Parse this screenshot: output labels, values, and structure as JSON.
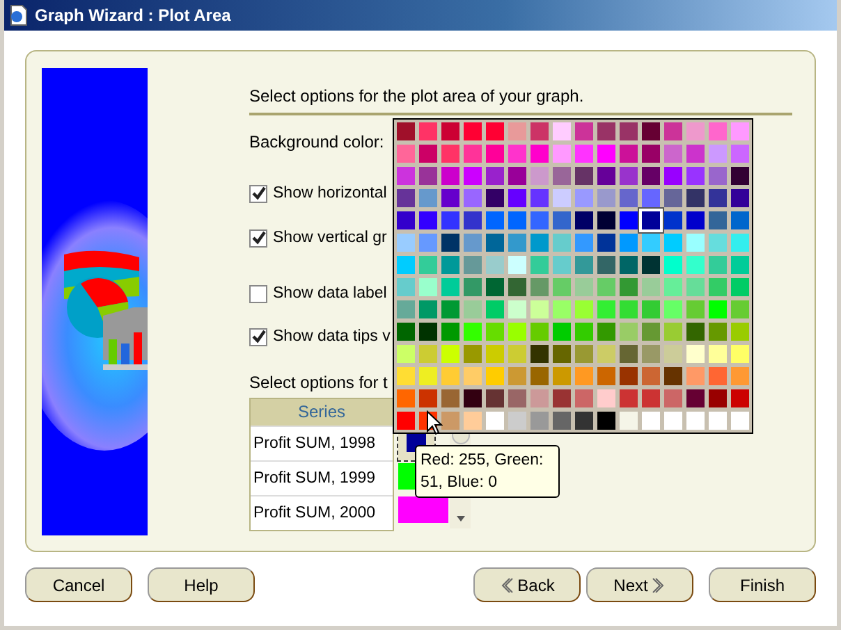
{
  "window": {
    "title": "Graph Wizard : Plot Area"
  },
  "heading": "Select options for the plot area of your graph.",
  "background_label": "Background color:",
  "options": [
    {
      "label": "Show horizontal",
      "checked": true
    },
    {
      "label": "Show vertical gr",
      "checked": true
    },
    {
      "label": "Show data label",
      "checked": false
    },
    {
      "label": "Show data tips v",
      "checked": true
    }
  ],
  "series_heading": "Select options for t",
  "series_table": {
    "header": "Series",
    "rows": [
      {
        "name": "Profit SUM, 1998",
        "color": "#000099"
      },
      {
        "name": "Profit SUM, 1999",
        "color": "#00ff00"
      },
      {
        "name": "Profit SUM, 2000",
        "color": "#ff00ff"
      }
    ]
  },
  "palette": {
    "rows": [
      {
        "swatches": [
          {
            "color": "#a0102a",
            "selected": false
          },
          {
            "color": "#ff3366",
            "selected": false
          },
          {
            "color": "#cc0033",
            "selected": false
          },
          {
            "color": "#ff0033",
            "selected": false
          },
          {
            "color": "#ff0033",
            "selected": false
          },
          {
            "color": "#e89a9a",
            "selected": false
          },
          {
            "color": "#cc3366",
            "selected": false
          },
          {
            "color": "#ffccff",
            "selected": false
          },
          {
            "color": "#cc3399",
            "selected": false
          },
          {
            "color": "#993366",
            "selected": false
          },
          {
            "color": "#993366",
            "selected": false
          },
          {
            "color": "#660033",
            "selected": false
          },
          {
            "color": "#cc3399",
            "selected": false
          },
          {
            "color": "#ee99cc",
            "selected": false
          },
          {
            "color": "#ff66cc",
            "selected": false
          },
          {
            "color": "#ff99ff",
            "selected": false
          }
        ]
      },
      {
        "swatches": [
          {
            "color": "#ff6699",
            "selected": false
          },
          {
            "color": "#cc0066",
            "selected": false
          },
          {
            "color": "#ff3366",
            "selected": false
          },
          {
            "color": "#ff3399",
            "selected": false
          },
          {
            "color": "#ff0099",
            "selected": false
          },
          {
            "color": "#ff33cc",
            "selected": false
          },
          {
            "color": "#ff00cc",
            "selected": false
          },
          {
            "color": "#ff99ff",
            "selected": false
          },
          {
            "color": "#ff33ff",
            "selected": false
          },
          {
            "color": "#ff00ff",
            "selected": false
          },
          {
            "color": "#cc1199",
            "selected": false
          },
          {
            "color": "#990066",
            "selected": false
          },
          {
            "color": "#cc66cc",
            "selected": false
          },
          {
            "color": "#cc33cc",
            "selected": false
          },
          {
            "color": "#cc99ff",
            "selected": false
          },
          {
            "color": "#cc66ff",
            "selected": false
          }
        ]
      },
      {
        "swatches": [
          {
            "color": "#cc33dd",
            "selected": false
          },
          {
            "color": "#993399",
            "selected": false
          },
          {
            "color": "#cc00cc",
            "selected": false
          },
          {
            "color": "#cc00ff",
            "selected": false
          },
          {
            "color": "#9922cc",
            "selected": false
          },
          {
            "color": "#990099",
            "selected": false
          },
          {
            "color": "#cc99cc",
            "selected": false
          },
          {
            "color": "#996699",
            "selected": false
          },
          {
            "color": "#663366",
            "selected": false
          },
          {
            "color": "#660099",
            "selected": false
          },
          {
            "color": "#9933cc",
            "selected": false
          },
          {
            "color": "#660066",
            "selected": false
          },
          {
            "color": "#9900ff",
            "selected": false
          },
          {
            "color": "#9933ff",
            "selected": false
          },
          {
            "color": "#9966cc",
            "selected": false
          },
          {
            "color": "#330033",
            "selected": false
          }
        ]
      },
      {
        "swatches": [
          {
            "color": "#663399",
            "selected": false
          },
          {
            "color": "#6699cc",
            "selected": false
          },
          {
            "color": "#6600cc",
            "selected": false
          },
          {
            "color": "#9966ff",
            "selected": false
          },
          {
            "color": "#330066",
            "selected": false
          },
          {
            "color": "#6600ff",
            "selected": false
          },
          {
            "color": "#6633ff",
            "selected": false
          },
          {
            "color": "#ccccff",
            "selected": false
          },
          {
            "color": "#9999ff",
            "selected": false
          },
          {
            "color": "#9999cc",
            "selected": false
          },
          {
            "color": "#6666cc",
            "selected": false
          },
          {
            "color": "#6666ff",
            "selected": false
          },
          {
            "color": "#666699",
            "selected": false
          },
          {
            "color": "#333366",
            "selected": false
          },
          {
            "color": "#333399",
            "selected": false
          },
          {
            "color": "#330099",
            "selected": false
          }
        ]
      },
      {
        "swatches": [
          {
            "color": "#3300cc",
            "selected": false
          },
          {
            "color": "#3300ff",
            "selected": false
          },
          {
            "color": "#3333ff",
            "selected": false
          },
          {
            "color": "#3333cc",
            "selected": false
          },
          {
            "color": "#0066ff",
            "selected": false
          },
          {
            "color": "#0066ff",
            "selected": false
          },
          {
            "color": "#3366ff",
            "selected": false
          },
          {
            "color": "#3366cc",
            "selected": false
          },
          {
            "color": "#000066",
            "selected": false
          },
          {
            "color": "#000033",
            "selected": false
          },
          {
            "color": "#0000ff",
            "selected": false
          },
          {
            "color": "#000099",
            "selected": true
          },
          {
            "color": "#0033cc",
            "selected": false
          },
          {
            "color": "#0000cc",
            "selected": false
          },
          {
            "color": "#336699",
            "selected": false
          },
          {
            "color": "#0066cc",
            "selected": false
          }
        ]
      },
      {
        "swatches": [
          {
            "color": "#99ccff",
            "selected": false
          },
          {
            "color": "#6699ff",
            "selected": false
          },
          {
            "color": "#003366",
            "selected": false
          },
          {
            "color": "#6699cc",
            "selected": false
          },
          {
            "color": "#006699",
            "selected": false
          },
          {
            "color": "#3399cc",
            "selected": false
          },
          {
            "color": "#0099cc",
            "selected": false
          },
          {
            "color": "#66cccc",
            "selected": false
          },
          {
            "color": "#3399ff",
            "selected": false
          },
          {
            "color": "#003399",
            "selected": false
          },
          {
            "color": "#0099ff",
            "selected": false
          },
          {
            "color": "#33ccff",
            "selected": false
          },
          {
            "color": "#00ccff",
            "selected": false
          },
          {
            "color": "#99ffff",
            "selected": false
          },
          {
            "color": "#66dddd",
            "selected": false
          },
          {
            "color": "#33eeee",
            "selected": false
          }
        ]
      },
      {
        "swatches": [
          {
            "color": "#00ccff",
            "selected": false
          },
          {
            "color": "#33cc99",
            "selected": false
          },
          {
            "color": "#009999",
            "selected": false
          },
          {
            "color": "#669999",
            "selected": false
          },
          {
            "color": "#99cccc",
            "selected": false
          },
          {
            "color": "#ccffff",
            "selected": false
          },
          {
            "color": "#33cc99",
            "selected": false
          },
          {
            "color": "#66cccc",
            "selected": false
          },
          {
            "color": "#339999",
            "selected": false
          },
          {
            "color": "#336666",
            "selected": false
          },
          {
            "color": "#006666",
            "selected": false
          },
          {
            "color": "#003333",
            "selected": false
          },
          {
            "color": "#00ffcc",
            "selected": false
          },
          {
            "color": "#33ffcc",
            "selected": false
          },
          {
            "color": "#33cc99",
            "selected": false
          },
          {
            "color": "#00cc99",
            "selected": false
          }
        ]
      },
      {
        "swatches": [
          {
            "color": "#66cccc",
            "selected": false
          },
          {
            "color": "#99ffcc",
            "selected": false
          },
          {
            "color": "#00cc99",
            "selected": false
          },
          {
            "color": "#339966",
            "selected": false
          },
          {
            "color": "#006633",
            "selected": false
          },
          {
            "color": "#336633",
            "selected": false
          },
          {
            "color": "#669966",
            "selected": false
          },
          {
            "color": "#66cc66",
            "selected": false
          },
          {
            "color": "#99cc99",
            "selected": false
          },
          {
            "color": "#66cc66",
            "selected": false
          },
          {
            "color": "#339933",
            "selected": false
          },
          {
            "color": "#99cc99",
            "selected": false
          },
          {
            "color": "#66ee99",
            "selected": false
          },
          {
            "color": "#66dd99",
            "selected": false
          },
          {
            "color": "#33cc66",
            "selected": false
          },
          {
            "color": "#00cc66",
            "selected": false
          }
        ]
      },
      {
        "swatches": [
          {
            "color": "#66aa99",
            "selected": false
          },
          {
            "color": "#009966",
            "selected": false
          },
          {
            "color": "#009933",
            "selected": false
          },
          {
            "color": "#99cc99",
            "selected": false
          },
          {
            "color": "#00cc66",
            "selected": false
          },
          {
            "color": "#ccffcc",
            "selected": false
          },
          {
            "color": "#ccff99",
            "selected": false
          },
          {
            "color": "#99ff66",
            "selected": false
          },
          {
            "color": "#99ff33",
            "selected": false
          },
          {
            "color": "#33ee33",
            "selected": false
          },
          {
            "color": "#33dd33",
            "selected": false
          },
          {
            "color": "#33cc33",
            "selected": false
          },
          {
            "color": "#66ff66",
            "selected": false
          },
          {
            "color": "#66cc33",
            "selected": false
          },
          {
            "color": "#00ff00",
            "selected": false
          },
          {
            "color": "#66cc33",
            "selected": false
          }
        ]
      },
      {
        "swatches": [
          {
            "color": "#006600",
            "selected": false
          },
          {
            "color": "#003300",
            "selected": false
          },
          {
            "color": "#009900",
            "selected": false
          },
          {
            "color": "#33ff00",
            "selected": false
          },
          {
            "color": "#66dd00",
            "selected": false
          },
          {
            "color": "#99ff00",
            "selected": false
          },
          {
            "color": "#66cc00",
            "selected": false
          },
          {
            "color": "#00cc00",
            "selected": false
          },
          {
            "color": "#33cc00",
            "selected": false
          },
          {
            "color": "#339900",
            "selected": false
          },
          {
            "color": "#99cc66",
            "selected": false
          },
          {
            "color": "#669933",
            "selected": false
          },
          {
            "color": "#99cc33",
            "selected": false
          },
          {
            "color": "#336600",
            "selected": false
          },
          {
            "color": "#669900",
            "selected": false
          },
          {
            "color": "#99cc00",
            "selected": false
          }
        ]
      },
      {
        "swatches": [
          {
            "color": "#ccff66",
            "selected": false
          },
          {
            "color": "#cccc33",
            "selected": false
          },
          {
            "color": "#ccff00",
            "selected": false
          },
          {
            "color": "#999900",
            "selected": false
          },
          {
            "color": "#cccc00",
            "selected": false
          },
          {
            "color": "#cccc33",
            "selected": false
          },
          {
            "color": "#333300",
            "selected": false
          },
          {
            "color": "#666600",
            "selected": false
          },
          {
            "color": "#999933",
            "selected": false
          },
          {
            "color": "#cccc66",
            "selected": false
          },
          {
            "color": "#666633",
            "selected": false
          },
          {
            "color": "#999966",
            "selected": false
          },
          {
            "color": "#cccc99",
            "selected": false
          },
          {
            "color": "#ffffcc",
            "selected": false
          },
          {
            "color": "#ffff99",
            "selected": false
          },
          {
            "color": "#ffff66",
            "selected": false
          }
        ]
      },
      {
        "swatches": [
          {
            "color": "#ffdd33",
            "selected": false
          },
          {
            "color": "#eeee22",
            "selected": false
          },
          {
            "color": "#ffcc33",
            "selected": false
          },
          {
            "color": "#ffcc66",
            "selected": false
          },
          {
            "color": "#ffcc00",
            "selected": false
          },
          {
            "color": "#cc9933",
            "selected": false
          },
          {
            "color": "#996600",
            "selected": false
          },
          {
            "color": "#cc9900",
            "selected": false
          },
          {
            "color": "#ff9922",
            "selected": false
          },
          {
            "color": "#cc6600",
            "selected": false
          },
          {
            "color": "#993300",
            "selected": false
          },
          {
            "color": "#cc6633",
            "selected": false
          },
          {
            "color": "#663300",
            "selected": false
          },
          {
            "color": "#ff9966",
            "selected": false
          },
          {
            "color": "#ff6633",
            "selected": false
          },
          {
            "color": "#ff9933",
            "selected": false
          }
        ]
      },
      {
        "swatches": [
          {
            "color": "#ff6600",
            "selected": false
          },
          {
            "color": "#cc3300",
            "selected": false
          },
          {
            "color": "#996633",
            "selected": false
          },
          {
            "color": "#330011",
            "selected": false
          },
          {
            "color": "#663333",
            "selected": false
          },
          {
            "color": "#996666",
            "selected": false
          },
          {
            "color": "#cc9999",
            "selected": false
          },
          {
            "color": "#993333",
            "selected": false
          },
          {
            "color": "#cc6666",
            "selected": false
          },
          {
            "color": "#ffcccc",
            "selected": false
          },
          {
            "color": "#cc3333",
            "selected": false
          },
          {
            "color": "#cc3333",
            "selected": false
          },
          {
            "color": "#cc6666",
            "selected": false
          },
          {
            "color": "#660033",
            "selected": false
          },
          {
            "color": "#990000",
            "selected": false
          },
          {
            "color": "#cc0000",
            "selected": false
          }
        ]
      },
      {
        "swatches": [
          {
            "color": "#ff0000",
            "selected": false
          },
          {
            "color": "#ff3300",
            "selected": false
          },
          {
            "color": "#cc9966",
            "selected": false
          },
          {
            "color": "#ffcc99",
            "selected": false
          },
          {
            "color": "#ffffff",
            "selected": false
          },
          {
            "color": "#cccccc",
            "selected": false
          },
          {
            "color": "#999999",
            "selected": false
          },
          {
            "color": "#666666",
            "selected": false
          },
          {
            "color": "#333333",
            "selected": false
          },
          {
            "color": "#000000",
            "selected": false
          },
          {
            "color": "#f5f5e8",
            "selected": false
          },
          {
            "color": "#ffffff",
            "selected": false
          },
          {
            "color": "#ffffff",
            "selected": false
          },
          {
            "color": "#ffffff",
            "selected": false
          },
          {
            "color": "#ffffff",
            "selected": false
          },
          {
            "color": "#ffffff",
            "selected": false
          }
        ]
      }
    ]
  },
  "tooltip": "Red: 255, Green: 51, Blue: 0",
  "buttons": [
    {
      "label": "Cancel",
      "kind": "plain"
    },
    {
      "label": "Help",
      "kind": "plain"
    },
    {
      "label": "Back",
      "kind": "back"
    },
    {
      "label": "Next",
      "kind": "next"
    },
    {
      "label": "Finish",
      "kind": "plain"
    }
  ]
}
